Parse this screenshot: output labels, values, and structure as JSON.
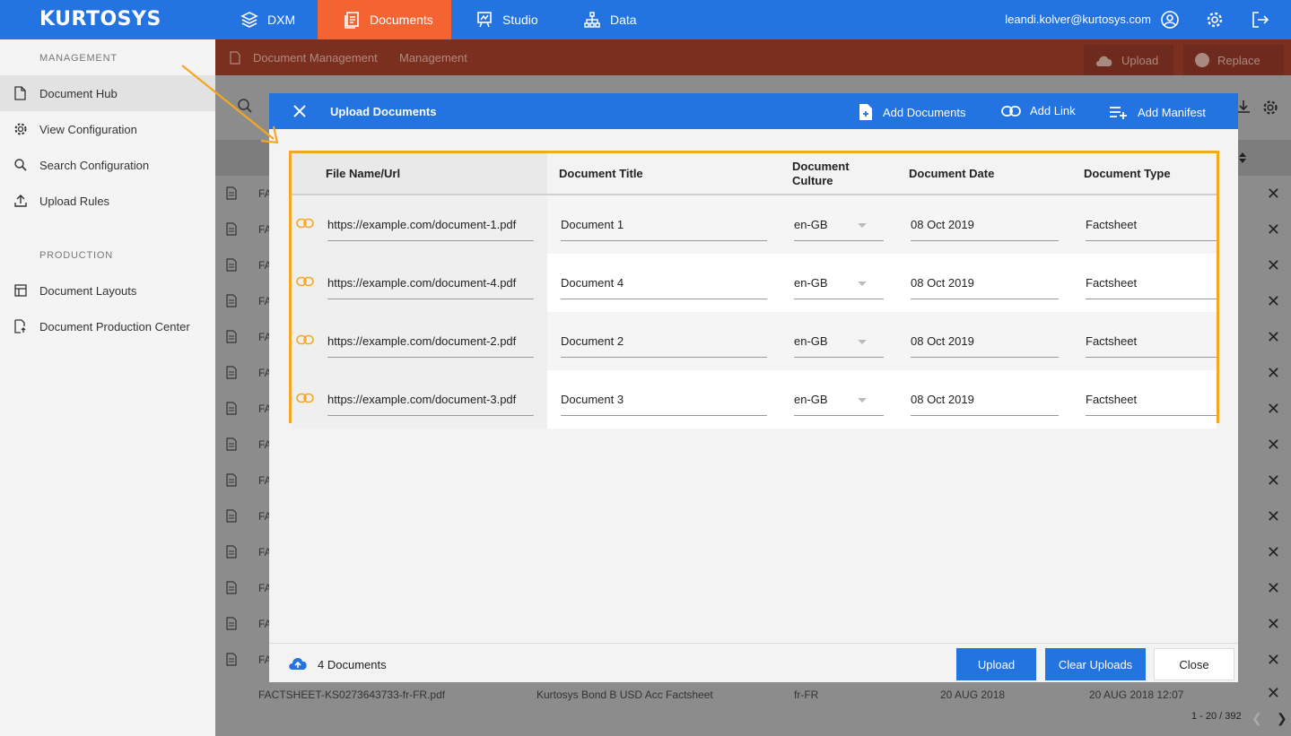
{
  "topbar": {
    "logo": "KURTOSYS",
    "nav": [
      {
        "label": "DXM",
        "icon": "layers-icon"
      },
      {
        "label": "Documents",
        "icon": "documents-icon"
      },
      {
        "label": "Studio",
        "icon": "studio-icon"
      },
      {
        "label": "Data",
        "icon": "data-tree-icon"
      }
    ],
    "user_email": "leandi.kolver@kurtosys.com",
    "colors": {
      "bar": "#2373e0",
      "active": "#f46432"
    }
  },
  "sidebar": {
    "management_label": "MANAGEMENT",
    "management_items": [
      {
        "label": "Document Hub",
        "icon": "document-icon"
      },
      {
        "label": "View Configuration",
        "icon": "gear-icon"
      },
      {
        "label": "Search Configuration",
        "icon": "search-icon"
      },
      {
        "label": "Upload Rules",
        "icon": "upload-icon"
      }
    ],
    "production_label": "PRODUCTION",
    "production_items": [
      {
        "label": "Document Layouts",
        "icon": "layout-icon"
      },
      {
        "label": "Document Production Center",
        "icon": "document-production-icon"
      }
    ]
  },
  "background": {
    "breadcrumb": [
      "Document Management",
      "Management"
    ],
    "upload_label": "Upload",
    "replace_label": "Replace",
    "row_prefix": "FA",
    "bottom_row": {
      "file": "FACTSHEET-KS0273643733-fr-FR.pdf",
      "title": "Kurtosys Bond B USD Acc Factsheet",
      "culture": "fr-FR",
      "date": "20 AUG 2018",
      "modified": "20 AUG 2018 12:07"
    },
    "pager": "1 - 20 / 392"
  },
  "modal": {
    "title": "Upload Documents",
    "actions": {
      "add_documents": "Add Documents",
      "add_link": "Add Link",
      "add_manifest": "Add Manifest"
    },
    "columns": {
      "file": "File Name/Url",
      "title": "Document Title",
      "culture_line1": "Document",
      "culture_line2": "Culture",
      "date": "Document Date",
      "type": "Document Type"
    },
    "rows": [
      {
        "url": "https://example.com/document-1.pdf",
        "title": "Document 1",
        "culture": "en-GB",
        "date": "08 Oct 2019",
        "type": "Factsheet"
      },
      {
        "url": "https://example.com/document-4.pdf",
        "title": "Document 4",
        "culture": "en-GB",
        "date": "08 Oct 2019",
        "type": "Factsheet"
      },
      {
        "url": "https://example.com/document-2.pdf",
        "title": "Document 2",
        "culture": "en-GB",
        "date": "08 Oct 2019",
        "type": "Factsheet"
      },
      {
        "url": "https://example.com/document-3.pdf",
        "title": "Document 3",
        "culture": "en-GB",
        "date": "08 Oct 2019",
        "type": "Factsheet"
      }
    ],
    "footer": {
      "count": "4 Documents",
      "upload": "Upload",
      "clear": "Clear Uploads",
      "close": "Close"
    },
    "highlight_color": "#f5a623"
  }
}
